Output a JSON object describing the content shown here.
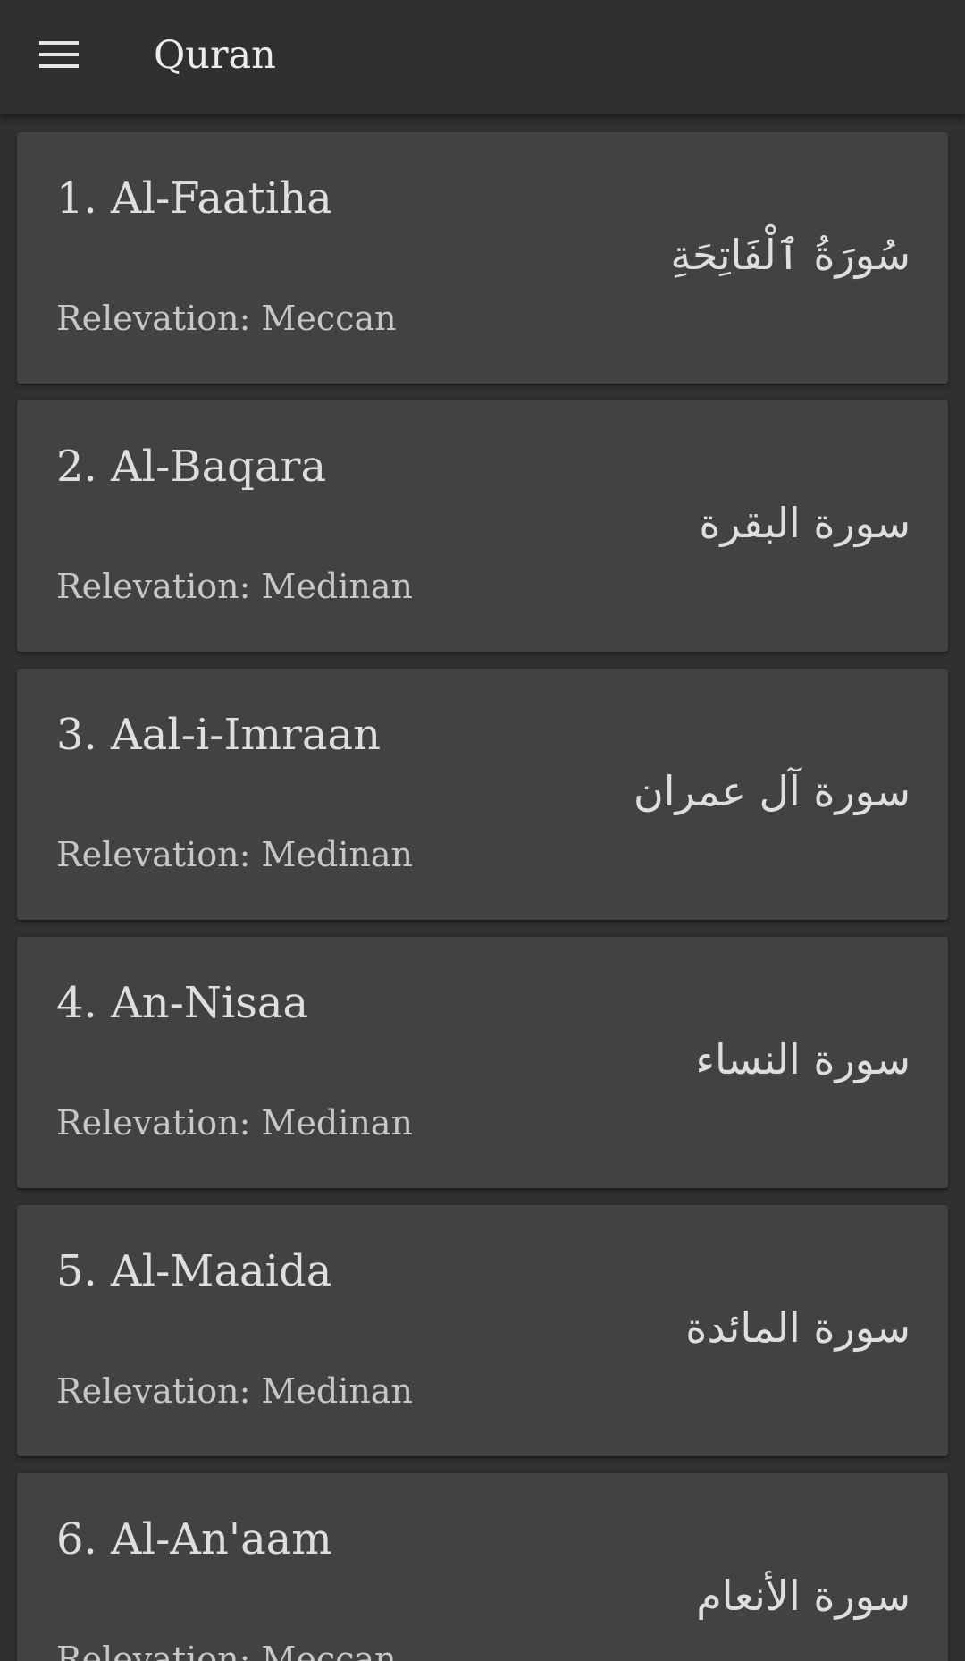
{
  "app": {
    "title": "Quran",
    "menu_icon": "hamburger-menu-icon"
  },
  "colors": {
    "background": "#303030",
    "card": "#424242",
    "text_primary": "#dedede",
    "text_secondary": "#c7c7c7"
  },
  "surahs": [
    {
      "title": "1. Al-Faatiha",
      "arabic": "سُورَةُ ٱلْفَاتِحَةِ",
      "revelation": "Relevation: Meccan"
    },
    {
      "title": "2. Al-Baqara",
      "arabic": "سورة البقرة",
      "revelation": "Relevation: Medinan"
    },
    {
      "title": "3. Aal-i-Imraan",
      "arabic": "سورة آل عمران",
      "revelation": "Relevation: Medinan"
    },
    {
      "title": "4. An-Nisaa",
      "arabic": "سورة النساء",
      "revelation": "Relevation: Medinan"
    },
    {
      "title": "5. Al-Maaida",
      "arabic": "سورة المائدة",
      "revelation": "Relevation: Medinan"
    },
    {
      "title": "6. Al-An'aam",
      "arabic": "سورة الأنعام",
      "revelation": "Relevation: Meccan"
    }
  ]
}
